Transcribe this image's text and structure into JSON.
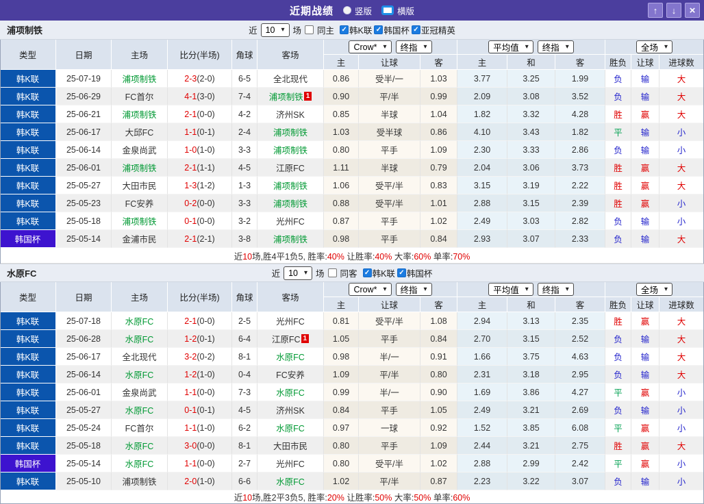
{
  "colors": {
    "accent_purple": "#4b3e9e",
    "league_badge_bg": "#0b55ad",
    "cup_badge_bg": "#3d13cf",
    "win_red": "#e00000",
    "lose_blue": "#2323cc",
    "draw_green": "#00a050",
    "focus_team_green": "#009933",
    "checkbox_blue": "#1b7be0"
  },
  "result_colors": {
    "胜": "red",
    "平": "green",
    "负": "blue",
    "赢": "red",
    "输": "blue",
    "大": "red",
    "小": "blue"
  },
  "titlebar": {
    "title": "近期战绩",
    "layout_vertical": "竖版",
    "layout_horizontal": "横版",
    "up_icon": "↑",
    "down_icon": "↓",
    "close_icon": "×"
  },
  "selects": {
    "source": "Crow*",
    "source_time": "终指",
    "avg": "平均值",
    "avg_time": "终指",
    "scope": "全场",
    "chevron": "▾"
  },
  "columns": {
    "type": "类型",
    "date": "日期",
    "home": "主场",
    "score": "比分(半场)",
    "corner": "角球",
    "away": "客场",
    "odds_home": "主",
    "odds_handicap": "让球",
    "odds_away": "客",
    "avg_home": "主",
    "avg_draw": "和",
    "avg_away": "客",
    "result": "胜负",
    "handicap_result": "让球",
    "goals": "进球数"
  },
  "sections": [
    {
      "team": "浦项制铁",
      "filter": {
        "near": "近",
        "count": "10",
        "unit": "场",
        "same": "同主",
        "same_checked": false,
        "leagues": [
          {
            "label": "韩K联",
            "checked": true
          },
          {
            "label": "韩国杯",
            "checked": true
          },
          {
            "label": "亚冠精英",
            "checked": true
          }
        ]
      },
      "rows": [
        {
          "type": "韩K联",
          "cup": false,
          "date": "25-07-19",
          "home": "浦项制铁",
          "hf": true,
          "hb": "",
          "score": "2-3",
          "half": "(2-0)",
          "corner": "6-5",
          "away": "全北现代",
          "af": false,
          "ab": "",
          "odds": [
            "0.86",
            "受半/一",
            "1.03"
          ],
          "avg": [
            "3.77",
            "3.25",
            "1.99"
          ],
          "res": [
            "负",
            "输",
            "大"
          ]
        },
        {
          "type": "韩K联",
          "cup": false,
          "date": "25-06-29",
          "home": "FC首尔",
          "hf": false,
          "hb": "",
          "score": "4-1",
          "half": "(3-0)",
          "corner": "7-4",
          "away": "浦项制铁",
          "af": true,
          "ab": "1",
          "odds": [
            "0.90",
            "平/半",
            "0.99"
          ],
          "avg": [
            "2.09",
            "3.08",
            "3.52"
          ],
          "res": [
            "负",
            "输",
            "大"
          ]
        },
        {
          "type": "韩K联",
          "cup": false,
          "date": "25-06-21",
          "home": "浦项制铁",
          "hf": true,
          "hb": "",
          "score": "2-1",
          "half": "(0-0)",
          "corner": "4-2",
          "away": "济州SK",
          "af": false,
          "ab": "",
          "odds": [
            "0.85",
            "半球",
            "1.04"
          ],
          "avg": [
            "1.82",
            "3.32",
            "4.28"
          ],
          "res": [
            "胜",
            "赢",
            "大"
          ]
        },
        {
          "type": "韩K联",
          "cup": false,
          "date": "25-06-17",
          "home": "大邱FC",
          "hf": false,
          "hb": "",
          "score": "1-1",
          "half": "(0-1)",
          "corner": "2-4",
          "away": "浦项制铁",
          "af": true,
          "ab": "",
          "odds": [
            "1.03",
            "受半球",
            "0.86"
          ],
          "avg": [
            "4.10",
            "3.43",
            "1.82"
          ],
          "res": [
            "平",
            "输",
            "小"
          ]
        },
        {
          "type": "韩K联",
          "cup": false,
          "date": "25-06-14",
          "home": "金泉尚武",
          "hf": false,
          "hb": "",
          "score": "1-0",
          "half": "(1-0)",
          "corner": "3-3",
          "away": "浦项制铁",
          "af": true,
          "ab": "",
          "odds": [
            "0.80",
            "平手",
            "1.09"
          ],
          "avg": [
            "2.30",
            "3.33",
            "2.86"
          ],
          "res": [
            "负",
            "输",
            "小"
          ]
        },
        {
          "type": "韩K联",
          "cup": false,
          "date": "25-06-01",
          "home": "浦项制铁",
          "hf": true,
          "hb": "",
          "score": "2-1",
          "half": "(1-1)",
          "corner": "4-5",
          "away": "江原FC",
          "af": false,
          "ab": "",
          "odds": [
            "1.11",
            "半球",
            "0.79"
          ],
          "avg": [
            "2.04",
            "3.06",
            "3.73"
          ],
          "res": [
            "胜",
            "赢",
            "大"
          ]
        },
        {
          "type": "韩K联",
          "cup": false,
          "date": "25-05-27",
          "home": "大田市民",
          "hf": false,
          "hb": "",
          "score": "1-3",
          "half": "(1-2)",
          "corner": "1-3",
          "away": "浦项制铁",
          "af": true,
          "ab": "",
          "odds": [
            "1.06",
            "受平/半",
            "0.83"
          ],
          "avg": [
            "3.15",
            "3.19",
            "2.22"
          ],
          "res": [
            "胜",
            "赢",
            "大"
          ]
        },
        {
          "type": "韩K联",
          "cup": false,
          "date": "25-05-23",
          "home": "FC安养",
          "hf": false,
          "hb": "",
          "score": "0-2",
          "half": "(0-0)",
          "corner": "3-3",
          "away": "浦项制铁",
          "af": true,
          "ab": "",
          "odds": [
            "0.88",
            "受平/半",
            "1.01"
          ],
          "avg": [
            "2.88",
            "3.15",
            "2.39"
          ],
          "res": [
            "胜",
            "赢",
            "小"
          ]
        },
        {
          "type": "韩K联",
          "cup": false,
          "date": "25-05-18",
          "home": "浦项制铁",
          "hf": true,
          "hb": "",
          "score": "0-1",
          "half": "(0-0)",
          "corner": "3-2",
          "away": "光州FC",
          "af": false,
          "ab": "",
          "odds": [
            "0.87",
            "平手",
            "1.02"
          ],
          "avg": [
            "2.49",
            "3.03",
            "2.82"
          ],
          "res": [
            "负",
            "输",
            "小"
          ]
        },
        {
          "type": "韩国杯",
          "cup": true,
          "date": "25-05-14",
          "home": "金浦市民",
          "hf": false,
          "hb": "",
          "score": "2-1",
          "half": "(2-1)",
          "corner": "3-8",
          "away": "浦项制铁",
          "af": true,
          "ab": "",
          "odds": [
            "0.98",
            "平手",
            "0.84"
          ],
          "avg": [
            "2.93",
            "3.07",
            "2.33"
          ],
          "res": [
            "负",
            "输",
            "大"
          ]
        }
      ],
      "summary": [
        {
          "t": "近"
        },
        {
          "t": "10",
          "red": true
        },
        {
          "t": "场,胜4平1负5, 胜率:"
        },
        {
          "t": "40%",
          "red": true
        },
        {
          "t": " 让胜率:"
        },
        {
          "t": "40%",
          "red": true
        },
        {
          "t": " 大率:"
        },
        {
          "t": "60%",
          "red": true
        },
        {
          "t": " 单率:"
        },
        {
          "t": "70%",
          "red": true
        }
      ]
    },
    {
      "team": "水原FC",
      "filter": {
        "near": "近",
        "count": "10",
        "unit": "场",
        "same": "同客",
        "same_checked": false,
        "leagues": [
          {
            "label": "韩K联",
            "checked": true
          },
          {
            "label": "韩国杯",
            "checked": true
          }
        ]
      },
      "rows": [
        {
          "type": "韩K联",
          "cup": false,
          "date": "25-07-18",
          "home": "水原FC",
          "hf": true,
          "hb": "",
          "score": "2-1",
          "half": "(0-0)",
          "corner": "2-5",
          "away": "光州FC",
          "af": false,
          "ab": "",
          "odds": [
            "0.81",
            "受平/半",
            "1.08"
          ],
          "avg": [
            "2.94",
            "3.13",
            "2.35"
          ],
          "res": [
            "胜",
            "赢",
            "大"
          ]
        },
        {
          "type": "韩K联",
          "cup": false,
          "date": "25-06-28",
          "home": "水原FC",
          "hf": true,
          "hb": "",
          "score": "1-2",
          "half": "(0-1)",
          "corner": "6-4",
          "away": "江原FC",
          "af": false,
          "ab": "1",
          "odds": [
            "1.05",
            "平手",
            "0.84"
          ],
          "avg": [
            "2.70",
            "3.15",
            "2.52"
          ],
          "res": [
            "负",
            "输",
            "大"
          ]
        },
        {
          "type": "韩K联",
          "cup": false,
          "date": "25-06-17",
          "home": "全北现代",
          "hf": false,
          "hb": "",
          "score": "3-2",
          "half": "(0-2)",
          "corner": "8-1",
          "away": "水原FC",
          "af": true,
          "ab": "",
          "odds": [
            "0.98",
            "半/一",
            "0.91"
          ],
          "avg": [
            "1.66",
            "3.75",
            "4.63"
          ],
          "res": [
            "负",
            "输",
            "大"
          ]
        },
        {
          "type": "韩K联",
          "cup": false,
          "date": "25-06-14",
          "home": "水原FC",
          "hf": true,
          "hb": "",
          "score": "1-2",
          "half": "(1-0)",
          "corner": "0-4",
          "away": "FC安养",
          "af": false,
          "ab": "",
          "odds": [
            "1.09",
            "平/半",
            "0.80"
          ],
          "avg": [
            "2.31",
            "3.18",
            "2.95"
          ],
          "res": [
            "负",
            "输",
            "大"
          ]
        },
        {
          "type": "韩K联",
          "cup": false,
          "date": "25-06-01",
          "home": "金泉尚武",
          "hf": false,
          "hb": "",
          "score": "1-1",
          "half": "(0-0)",
          "corner": "7-3",
          "away": "水原FC",
          "af": true,
          "ab": "",
          "odds": [
            "0.99",
            "半/一",
            "0.90"
          ],
          "avg": [
            "1.69",
            "3.86",
            "4.27"
          ],
          "res": [
            "平",
            "赢",
            "小"
          ]
        },
        {
          "type": "韩K联",
          "cup": false,
          "date": "25-05-27",
          "home": "水原FC",
          "hf": true,
          "hb": "",
          "score": "0-1",
          "half": "(0-1)",
          "corner": "4-5",
          "away": "济州SK",
          "af": false,
          "ab": "",
          "odds": [
            "0.84",
            "平手",
            "1.05"
          ],
          "avg": [
            "2.49",
            "3.21",
            "2.69"
          ],
          "res": [
            "负",
            "输",
            "小"
          ]
        },
        {
          "type": "韩K联",
          "cup": false,
          "date": "25-05-24",
          "home": "FC首尔",
          "hf": false,
          "hb": "",
          "score": "1-1",
          "half": "(1-0)",
          "corner": "6-2",
          "away": "水原FC",
          "af": true,
          "ab": "",
          "odds": [
            "0.97",
            "一球",
            "0.92"
          ],
          "avg": [
            "1.52",
            "3.85",
            "6.08"
          ],
          "res": [
            "平",
            "赢",
            "小"
          ]
        },
        {
          "type": "韩K联",
          "cup": false,
          "date": "25-05-18",
          "home": "水原FC",
          "hf": true,
          "hb": "",
          "score": "3-0",
          "half": "(0-0)",
          "corner": "8-1",
          "away": "大田市民",
          "af": false,
          "ab": "",
          "odds": [
            "0.80",
            "平手",
            "1.09"
          ],
          "avg": [
            "2.44",
            "3.21",
            "2.75"
          ],
          "res": [
            "胜",
            "赢",
            "大"
          ]
        },
        {
          "type": "韩国杯",
          "cup": true,
          "date": "25-05-14",
          "home": "水原FC",
          "hf": true,
          "hb": "",
          "score": "1-1",
          "half": "(0-0)",
          "corner": "2-7",
          "away": "光州FC",
          "af": false,
          "ab": "",
          "odds": [
            "0.80",
            "受平/半",
            "1.02"
          ],
          "avg": [
            "2.88",
            "2.99",
            "2.42"
          ],
          "res": [
            "平",
            "赢",
            "小"
          ]
        },
        {
          "type": "韩K联",
          "cup": false,
          "date": "25-05-10",
          "home": "浦项制铁",
          "hf": false,
          "hb": "",
          "score": "2-0",
          "half": "(1-0)",
          "corner": "6-6",
          "away": "水原FC",
          "af": true,
          "ab": "",
          "odds": [
            "1.02",
            "平/半",
            "0.87"
          ],
          "avg": [
            "2.23",
            "3.22",
            "3.07"
          ],
          "res": [
            "负",
            "输",
            "小"
          ]
        }
      ],
      "summary": [
        {
          "t": "近"
        },
        {
          "t": "10",
          "red": true
        },
        {
          "t": "场,胜2平3负5, 胜率:"
        },
        {
          "t": "20%",
          "red": true
        },
        {
          "t": " 让胜率:"
        },
        {
          "t": "50%",
          "red": true
        },
        {
          "t": " 大率:"
        },
        {
          "t": "50%",
          "red": true
        },
        {
          "t": " 单率:"
        },
        {
          "t": "60%",
          "red": true
        }
      ]
    }
  ]
}
